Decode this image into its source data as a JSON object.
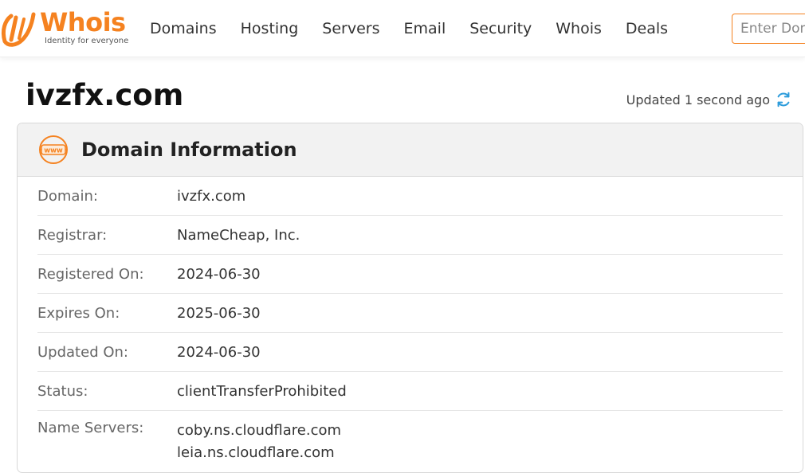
{
  "brand": {
    "name": "Whois",
    "tagline": "Identity for everyone",
    "color": "#f58220"
  },
  "nav": {
    "items": [
      {
        "label": "Domains"
      },
      {
        "label": "Hosting"
      },
      {
        "label": "Servers"
      },
      {
        "label": "Email"
      },
      {
        "label": "Security"
      },
      {
        "label": "Whois"
      },
      {
        "label": "Deals"
      }
    ]
  },
  "search": {
    "placeholder": "Enter Domain"
  },
  "page": {
    "title": "ivzfx.com",
    "updated": "Updated 1 second ago"
  },
  "domain_info": {
    "title": "Domain Information",
    "rows": [
      {
        "label": "Domain:",
        "value": "ivzfx.com"
      },
      {
        "label": "Registrar:",
        "value": "NameCheap, Inc."
      },
      {
        "label": "Registered On:",
        "value": "2024-06-30"
      },
      {
        "label": "Expires On:",
        "value": "2025-06-30"
      },
      {
        "label": "Updated On:",
        "value": "2024-06-30"
      },
      {
        "label": "Status:",
        "value": "clientTransferProhibited"
      }
    ],
    "name_servers": {
      "label": "Name Servers:",
      "values": [
        "coby.ns.cloudflare.com",
        "leia.ns.cloudflare.com"
      ]
    }
  },
  "icons": {
    "logo": "whois-logo-icon",
    "refresh": "refresh-icon",
    "www": "www-globe-icon"
  }
}
